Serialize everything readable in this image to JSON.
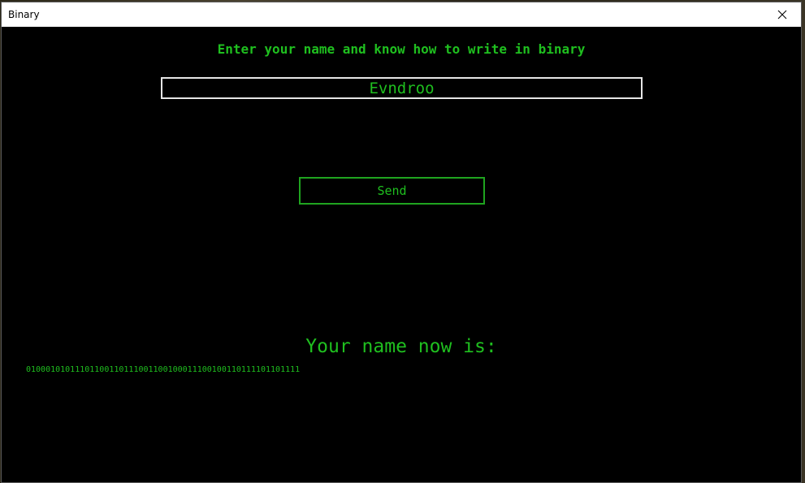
{
  "window": {
    "title": "Binary"
  },
  "main": {
    "heading": "Enter your name and know how to write in binary",
    "name_input": {
      "value": "Evndroo",
      "placeholder": ""
    },
    "send_label": "Send",
    "result_label": "Your name now is:",
    "binary_output": "01000101011101100110111001100100011100100110111101101111"
  },
  "colors": {
    "background": "#000000",
    "text_green": "#1fbf1f",
    "button_border": "#1fa41f",
    "input_border": "#e6e6e6",
    "titlebar": "#ffffff"
  },
  "icons": {
    "close": "close-icon"
  }
}
